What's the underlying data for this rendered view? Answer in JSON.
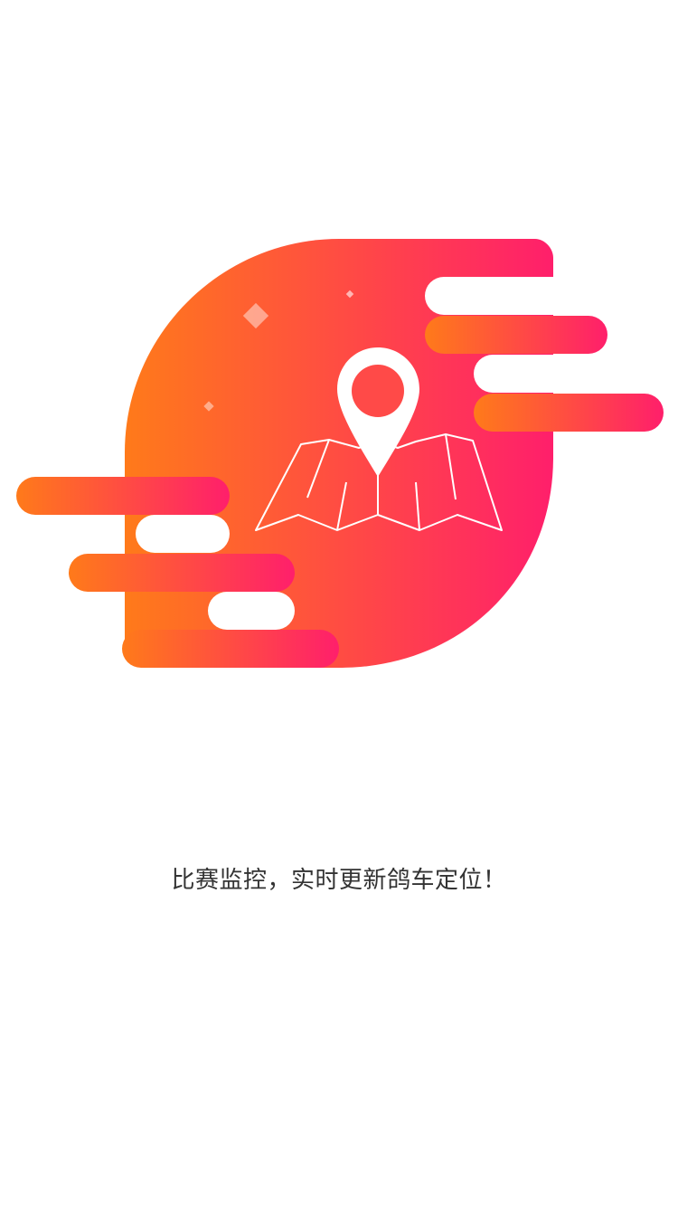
{
  "onboarding": {
    "caption": "比赛监控，实时更新鸽车定位！",
    "illustration_icon": "map-location-pin-icon",
    "colors": {
      "gradient_start": "#FF7A1A",
      "gradient_end": "#FF1F6B",
      "caption_text": "#333333",
      "background": "#FFFFFF",
      "icon_stroke": "#FFFFFF"
    }
  }
}
